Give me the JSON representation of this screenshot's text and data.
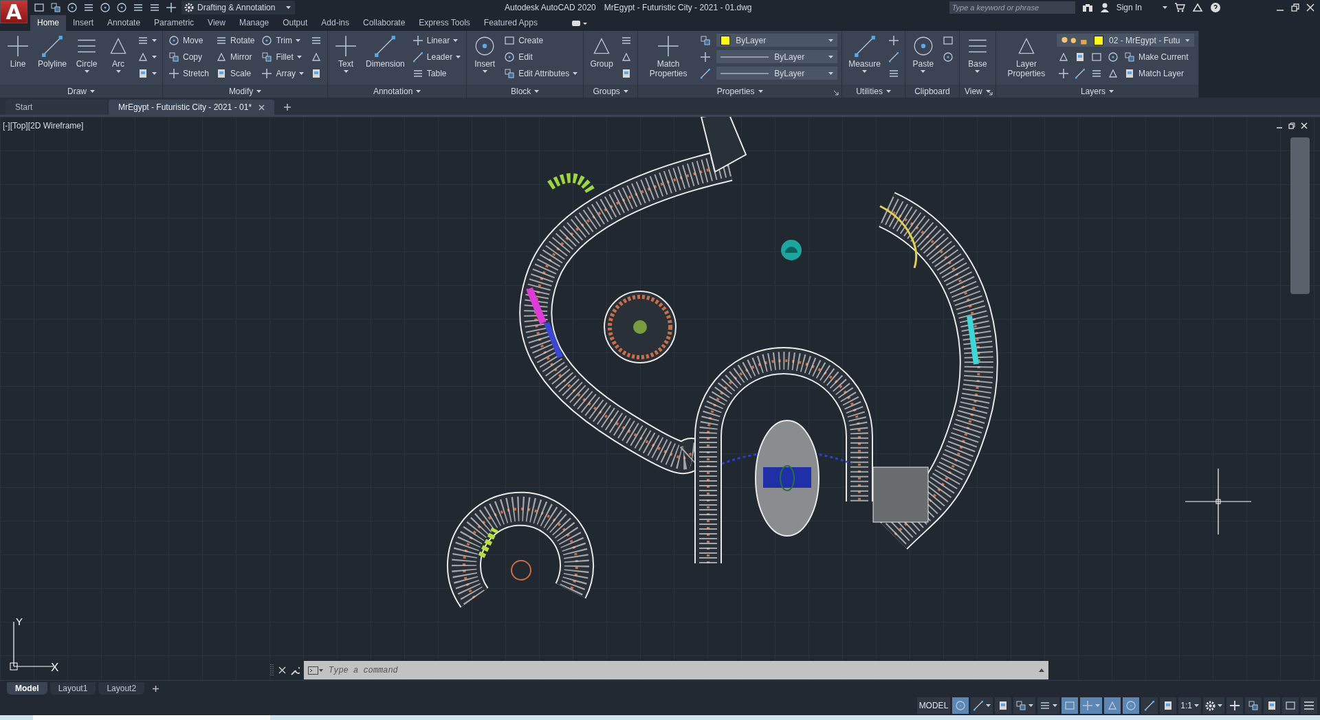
{
  "app_menu": {
    "label": "A"
  },
  "workspace": "Drafting & Annotation",
  "title": {
    "app": "Autodesk AutoCAD 2020",
    "file": "MrEgypt - Futuristic City - 2021 - 01.dwg"
  },
  "search": {
    "placeholder": "Type a keyword or phrase"
  },
  "sign_in": "Sign In",
  "ribbon_tabs": [
    {
      "label": "Home",
      "selected": true
    },
    {
      "label": "Insert",
      "selected": false
    },
    {
      "label": "Annotate",
      "selected": false
    },
    {
      "label": "Parametric",
      "selected": false
    },
    {
      "label": "View",
      "selected": false
    },
    {
      "label": "Manage",
      "selected": false
    },
    {
      "label": "Output",
      "selected": false
    },
    {
      "label": "Add-ins",
      "selected": false
    },
    {
      "label": "Collaborate",
      "selected": false
    },
    {
      "label": "Express Tools",
      "selected": false
    },
    {
      "label": "Featured Apps",
      "selected": false
    }
  ],
  "panels": [
    {
      "title": "Draw",
      "menu": true,
      "launcher": false,
      "columns": [
        {
          "kind": "large",
          "label": "Line",
          "menu": false
        },
        {
          "kind": "large",
          "label": "Polyline",
          "menu": false
        },
        {
          "kind": "large",
          "label": "Circle",
          "menu": true
        },
        {
          "kind": "large",
          "label": "Arc",
          "menu": true
        },
        {
          "kind": "stack",
          "rows": [
            [
              {
                "kind": "tool",
                "menu": true
              }
            ],
            [
              {
                "kind": "tool",
                "menu": true
              }
            ],
            [
              {
                "kind": "tool",
                "menu": true
              }
            ]
          ]
        }
      ]
    },
    {
      "title": "Modify",
      "menu": true,
      "launcher": false,
      "columns": [
        {
          "kind": "stack",
          "rows": [
            [
              {
                "kind": "tool",
                "label": "Move",
                "menu": false
              }
            ],
            [
              {
                "kind": "tool",
                "label": "Copy",
                "menu": false
              }
            ],
            [
              {
                "kind": "tool",
                "label": "Stretch",
                "menu": false
              }
            ]
          ]
        },
        {
          "kind": "stack",
          "rows": [
            [
              {
                "kind": "tool",
                "label": "Rotate",
                "menu": false
              }
            ],
            [
              {
                "kind": "tool",
                "label": "Mirror",
                "menu": false
              }
            ],
            [
              {
                "kind": "tool",
                "label": "Scale",
                "menu": false
              }
            ]
          ]
        },
        {
          "kind": "stack",
          "rows": [
            [
              {
                "kind": "tool",
                "label": "Trim",
                "menu": true
              }
            ],
            [
              {
                "kind": "tool",
                "label": "Fillet",
                "menu": true
              }
            ],
            [
              {
                "kind": "tool",
                "label": "Array",
                "menu": true
              }
            ]
          ]
        },
        {
          "kind": "stack",
          "rows": [
            [
              {
                "kind": "tool",
                "menu": false
              }
            ],
            [
              {
                "kind": "tool",
                "menu": false
              }
            ],
            [
              {
                "kind": "tool",
                "menu": false
              }
            ]
          ]
        }
      ]
    },
    {
      "title": "Annotation",
      "menu": true,
      "launcher": false,
      "columns": [
        {
          "kind": "large",
          "label": "Text",
          "menu": true
        },
        {
          "kind": "large",
          "label": "Dimension",
          "menu": false
        },
        {
          "kind": "stack",
          "rows": [
            [
              {
                "kind": "tool",
                "label": "Linear",
                "menu": true
              }
            ],
            [
              {
                "kind": "tool",
                "label": "Leader",
                "menu": true
              }
            ],
            [
              {
                "kind": "tool",
                "label": "Table",
                "menu": false
              }
            ]
          ]
        }
      ]
    },
    {
      "title": "Block",
      "menu": true,
      "launcher": false,
      "columns": [
        {
          "kind": "large",
          "label": "Insert",
          "menu": true
        },
        {
          "kind": "stack",
          "rows": [
            [
              {
                "kind": "tool",
                "label": "Create",
                "menu": false
              }
            ],
            [
              {
                "kind": "tool",
                "label": "Edit",
                "menu": false
              }
            ],
            [
              {
                "kind": "tool",
                "label": "Edit Attributes",
                "menu": true
              }
            ]
          ]
        }
      ]
    },
    {
      "title": "Groups",
      "menu": true,
      "launcher": false,
      "columns": [
        {
          "kind": "large",
          "label": "Group",
          "menu": false
        },
        {
          "kind": "stack",
          "rows": [
            [
              {
                "kind": "tool",
                "menu": false
              }
            ],
            [
              {
                "kind": "tool",
                "menu": false
              }
            ],
            [
              {
                "kind": "tool",
                "menu": false
              }
            ]
          ]
        }
      ]
    },
    {
      "title": "Properties",
      "menu": true,
      "launcher": true,
      "columns": [
        {
          "kind": "large",
          "label": "Match Properties",
          "menu": false
        },
        {
          "kind": "stack",
          "rows": [
            [
              {
                "kind": "tool",
                "menu": false
              }
            ],
            [
              {
                "kind": "tool",
                "menu": false
              }
            ],
            [
              {
                "kind": "tool",
                "menu": false
              }
            ]
          ]
        },
        {
          "kind": "stack",
          "rows": [
            [
              {
                "kind": "color-dropdown",
                "label": "ByLayer",
                "color": "#ffff00"
              }
            ],
            [
              {
                "kind": "line-dropdown",
                "label": "ByLayer"
              }
            ],
            [
              {
                "kind": "line-dropdown",
                "label": "ByLayer"
              }
            ]
          ]
        }
      ]
    },
    {
      "title": "Utilities",
      "menu": true,
      "launcher": false,
      "columns": [
        {
          "kind": "large",
          "label": "Measure",
          "menu": true
        },
        {
          "kind": "stack",
          "rows": [
            [
              {
                "kind": "tool",
                "menu": false
              }
            ],
            [
              {
                "kind": "tool",
                "menu": false
              }
            ],
            [
              {
                "kind": "tool",
                "menu": false
              }
            ]
          ]
        }
      ]
    },
    {
      "title": "Clipboard",
      "menu": false,
      "launcher": false,
      "columns": [
        {
          "kind": "large",
          "label": "Paste",
          "menu": true
        },
        {
          "kind": "stack",
          "rows": [
            [
              {
                "kind": "tool",
                "menu": false
              }
            ],
            [
              {
                "kind": "tool",
                "menu": false
              }
            ]
          ]
        }
      ]
    },
    {
      "title": "View",
      "menu": true,
      "launcher": true,
      "columns": [
        {
          "kind": "large",
          "label": "Base",
          "menu": true
        }
      ]
    },
    {
      "title": "Layers",
      "menu": true,
      "launcher": false,
      "columns": [
        {
          "kind": "large",
          "label": "Layer Properties",
          "menu": false
        },
        {
          "kind": "stack",
          "rows": [
            [
              {
                "kind": "layer-dropdown",
                "label": "02 - MrEgypt - Futu",
                "color": "#ffff00"
              }
            ],
            [
              {
                "kind": "tool",
                "menu": false
              },
              {
                "kind": "tool",
                "menu": false
              },
              {
                "kind": "tool",
                "menu": false
              },
              {
                "kind": "tool",
                "menu": false
              },
              {
                "kind": "tool",
                "label": "Make Current",
                "menu": false
              }
            ],
            [
              {
                "kind": "tool",
                "menu": false
              },
              {
                "kind": "tool",
                "menu": false
              },
              {
                "kind": "tool",
                "menu": false
              },
              {
                "kind": "tool",
                "menu": false
              },
              {
                "kind": "tool",
                "label": "Match Layer",
                "menu": false
              }
            ]
          ]
        }
      ]
    }
  ],
  "doc_tabs": [
    {
      "label": "Start",
      "selected": false
    },
    {
      "label": "MrEgypt - Futuristic City - 2021 - 01*",
      "selected": true
    }
  ],
  "viewport": {
    "label": "[-][Top][2D Wireframe]",
    "axis_x": "X",
    "axis_y": "Y"
  },
  "command_line": {
    "placeholder": "Type a command"
  },
  "layout_tabs": [
    {
      "label": "Model",
      "selected": true
    },
    {
      "label": "Layout1",
      "selected": false
    },
    {
      "label": "Layout2",
      "selected": false
    }
  ],
  "status_bar": {
    "model": "MODEL",
    "annotation_scale": "1:1",
    "toggles": [
      {
        "on": true,
        "menu": false
      },
      {
        "on": false,
        "menu": true
      },
      {
        "on": false,
        "menu": false
      },
      {
        "on": false,
        "menu": true
      },
      {
        "on": false,
        "menu": true
      },
      {
        "on": true,
        "menu": false
      },
      {
        "on": true,
        "menu": true
      },
      {
        "on": true,
        "menu": false
      },
      {
        "on": true,
        "menu": false
      },
      {
        "on": false,
        "menu": false
      },
      {
        "on": false,
        "menu": false
      }
    ]
  }
}
